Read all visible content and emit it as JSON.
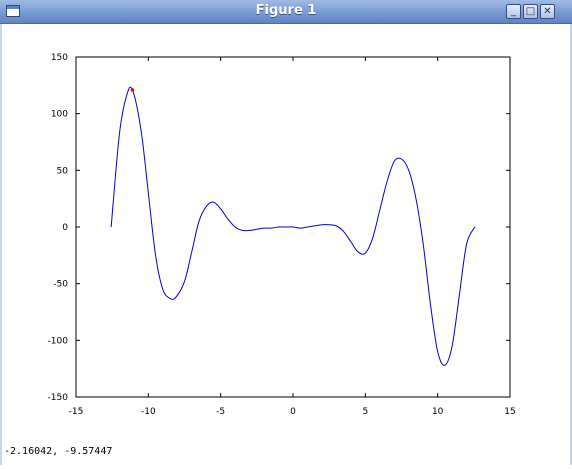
{
  "window": {
    "title": "Figure 1",
    "icon": "figure-window-icon",
    "controls": [
      {
        "name": "minimize",
        "glyph": "_"
      },
      {
        "name": "maximize",
        "glyph": "□"
      },
      {
        "name": "close",
        "glyph": "✕"
      }
    ]
  },
  "status": {
    "coordinates": "-2.16042, -9.57447"
  },
  "chart_data": {
    "type": "line",
    "title": "",
    "xlabel": "",
    "ylabel": "",
    "xlim": [
      -15,
      15
    ],
    "ylim": [
      -150,
      150
    ],
    "x_ticks": [
      "-15",
      "-10",
      "-5",
      "0",
      "5",
      "10",
      "15"
    ],
    "y_ticks": [
      "150",
      "100",
      "50",
      "0",
      "-50",
      "-100",
      "-150"
    ],
    "grid": false,
    "colors": {
      "line": "#0000cc",
      "marker": "#ff0000"
    },
    "series": [
      {
        "x": [
          -12.57,
          -12.0,
          -11.5,
          -11.1,
          -10.5,
          -10.0,
          -9.5,
          -9.0,
          -8.5,
          -8.1,
          -7.5,
          -7.0,
          -6.5,
          -6.0,
          -5.5,
          -5.0,
          -4.5,
          -4.0,
          -3.5,
          -3.0,
          -2.5,
          -2.0,
          -1.5,
          -1.0,
          -0.5,
          0.0,
          0.5,
          1.0,
          1.5,
          2.0,
          2.5,
          3.0,
          3.5,
          4.0,
          4.5,
          5.0,
          5.5,
          6.0,
          6.5,
          7.0,
          7.5,
          8.0,
          8.5,
          9.0,
          9.5,
          10.0,
          10.5,
          11.0,
          11.5,
          12.0,
          12.57
        ],
        "y": [
          0,
          82,
          116,
          121,
          85,
          30,
          -25,
          -55,
          -63,
          -62,
          -48,
          -22,
          5,
          18,
          22,
          16,
          7,
          0,
          -3,
          -3,
          -2,
          -1,
          -1,
          0,
          0,
          0,
          -1,
          0,
          1,
          2,
          2,
          1,
          -4,
          -13,
          -22,
          -23,
          -10,
          15,
          40,
          58,
          60,
          50,
          25,
          -15,
          -68,
          -110,
          -122,
          -105,
          -60,
          -15,
          0
        ]
      }
    ],
    "marker": {
      "x": -11.1,
      "y": 121
    }
  }
}
